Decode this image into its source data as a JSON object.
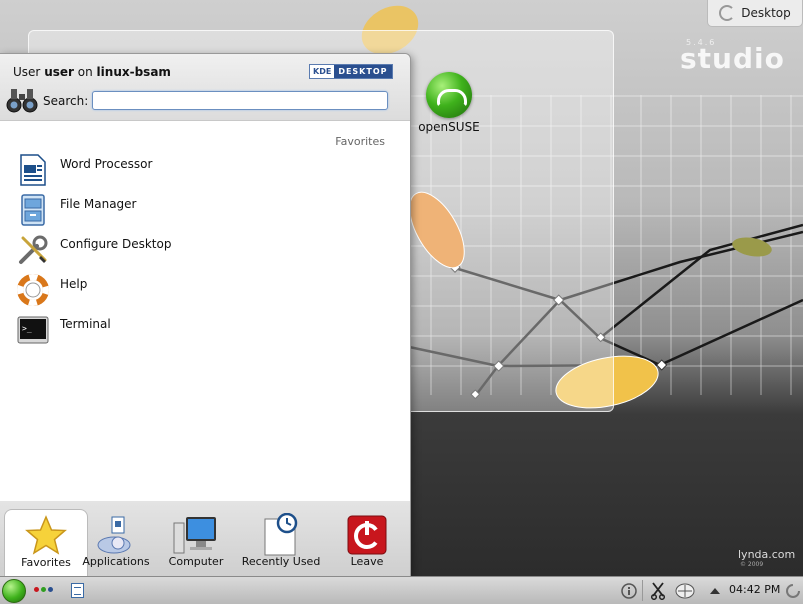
{
  "desktop": {
    "toolbox_button": "Desktop",
    "icon_label": "openSUSE",
    "wallpaper_logo": "studio",
    "wallpaper_sub": "5.4.6",
    "watermark": "lynda.com",
    "watermark_sub": "© 2009"
  },
  "menu": {
    "user_prefix": "User",
    "user_name": "user",
    "user_mid": "on",
    "host": "linux-bsam",
    "badge_left": "KDE",
    "badge_right": "DESKTOP",
    "search_label": "Search:",
    "search_value": "",
    "section_title": "Favorites",
    "items": [
      {
        "label": "Word Processor",
        "icon": "word-processor-icon"
      },
      {
        "label": "File Manager",
        "icon": "file-manager-icon"
      },
      {
        "label": "Configure Desktop",
        "icon": "configure-desktop-icon"
      },
      {
        "label": "Help",
        "icon": "help-lifebuoy-icon"
      },
      {
        "label": "Terminal",
        "icon": "terminal-icon"
      }
    ],
    "tabs": [
      {
        "label": "Favorites",
        "icon": "star-icon",
        "active": true
      },
      {
        "label": "Applications",
        "icon": "applications-icon",
        "active": false
      },
      {
        "label": "Computer",
        "icon": "computer-icon",
        "active": false
      },
      {
        "label": "Recently Used",
        "icon": "recently-used-icon",
        "active": false
      },
      {
        "label": "Leave",
        "icon": "power-icon",
        "active": false
      }
    ]
  },
  "panel": {
    "clock": "04:42 PM",
    "tray_icons": [
      "info-icon",
      "clipboard-scissors-icon",
      "network-icon",
      "expand-tray-icon"
    ]
  },
  "colors": {
    "accent": "#2a4f8f",
    "leave_red": "#c8161d",
    "opensuse_green": "#3fb21c"
  }
}
